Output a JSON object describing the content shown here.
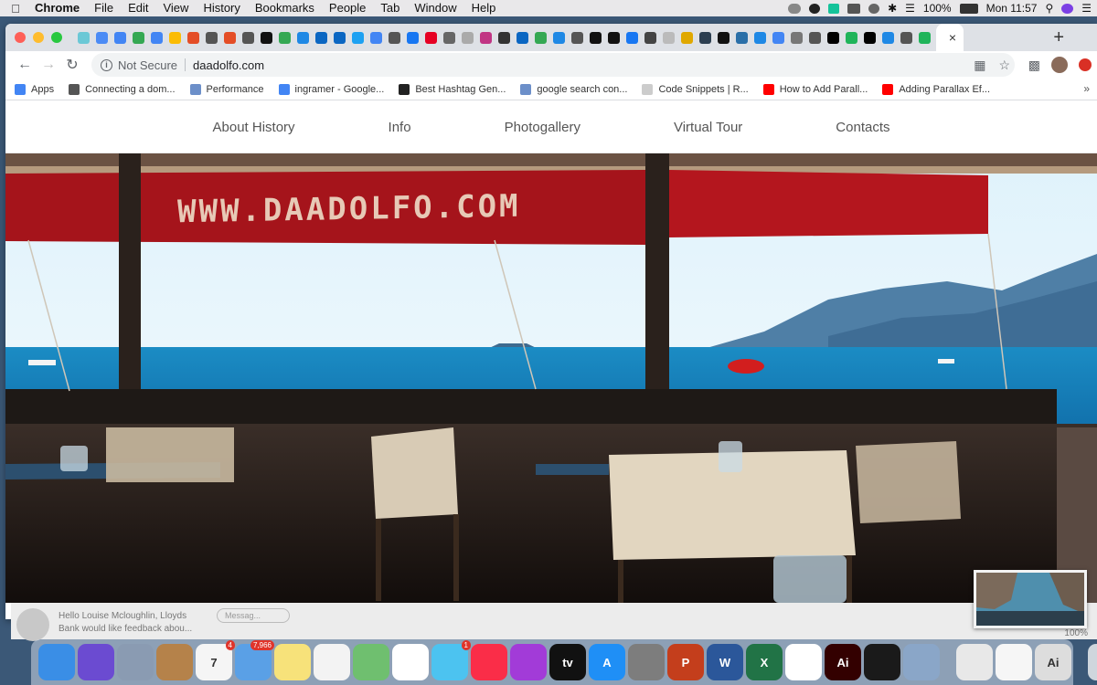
{
  "menubar": {
    "app": "Chrome",
    "items": [
      "File",
      "Edit",
      "View",
      "History",
      "Bookmarks",
      "People",
      "Tab",
      "Window",
      "Help"
    ],
    "battery": "100%",
    "clock": "Mon 11:57"
  },
  "browser": {
    "traffic_colors": [
      "#fe5f57",
      "#febc2e",
      "#28c840"
    ],
    "tab_icon_colors": [
      "#6bc8d6",
      "#4b8bf5",
      "#4285f4",
      "#34a853",
      "#4285f4",
      "#fbbc05",
      "#e44d26",
      "#555555",
      "#e44d26",
      "#555555",
      "#111111",
      "#34a853",
      "#1e88e5",
      "#0a66c2",
      "#0a66c2",
      "#1da1f2",
      "#4285f4",
      "#555555",
      "#1877f2",
      "#e60023",
      "#666666",
      "#aaaaaa",
      "#c13584",
      "#333333",
      "#0a66c2",
      "#34a853",
      "#1e88e5",
      "#555555",
      "#111111",
      "#111111",
      "#1877f2",
      "#444444",
      "#bbbbbb",
      "#e0a800",
      "#2c3e50",
      "#111111",
      "#2a6fa8",
      "#1e88e5",
      "#4285f4",
      "#777777",
      "#555555",
      "#000000",
      "#1fb45a",
      "#000000",
      "#1e88e5",
      "#555555",
      "#1fb45a"
    ],
    "active_tab_close": "×",
    "new_tab": "+",
    "address": {
      "security": "Not Secure",
      "url": "daadolfo.com"
    },
    "bookmarks": [
      {
        "label": "Apps",
        "color": "#4285f4"
      },
      {
        "label": "Connecting a dom...",
        "color": "#555555"
      },
      {
        "label": "Performance",
        "color": "#6c8fc9"
      },
      {
        "label": "ingramer - Google...",
        "color": "#4285f4"
      },
      {
        "label": "Best Hashtag Gen...",
        "color": "#222222"
      },
      {
        "label": "google search con...",
        "color": "#6c8fc9"
      },
      {
        "label": "Code Snippets | R...",
        "color": "#cccccc"
      },
      {
        "label": "How to Add Parall...",
        "color": "#ff0000"
      },
      {
        "label": "Adding Parallax Ef...",
        "color": "#ff0000"
      }
    ],
    "bookmarks_more": "»"
  },
  "site": {
    "nav": [
      "About History",
      "Info",
      "Photogallery",
      "Virtual Tour",
      "Contacts"
    ],
    "hero_banner_text": "WWW.DAADOLFO.COM"
  },
  "behind_window": {
    "message": "Hello Louise Mcloughlin, Lloyds Bank would like feedback abou...",
    "message_box": "Messag...",
    "zoom": "100%"
  },
  "dock": {
    "apps": [
      {
        "name": "finder",
        "label": "",
        "color": "#3a8ee6"
      },
      {
        "name": "siri",
        "label": "",
        "color": "#6b4bd1"
      },
      {
        "name": "launchpad",
        "label": "",
        "color": "#8a9bb2"
      },
      {
        "name": "notefile",
        "label": "",
        "color": "#b5824a"
      },
      {
        "name": "calendar",
        "label": "7",
        "color": "#f5f5f5",
        "badge": "4"
      },
      {
        "name": "mail",
        "label": "",
        "color": "#5aa0e6",
        "badge": "7,966"
      },
      {
        "name": "notes",
        "label": "",
        "color": "#f7e27a"
      },
      {
        "name": "reminders",
        "label": "",
        "color": "#f3f3f3"
      },
      {
        "name": "maps",
        "label": "",
        "color": "#6fbf6f"
      },
      {
        "name": "photos",
        "label": "",
        "color": "#ffffff"
      },
      {
        "name": "messages",
        "label": "",
        "color": "#4cc3f0",
        "badge": "1"
      },
      {
        "name": "music",
        "label": "",
        "color": "#fa2d48"
      },
      {
        "name": "podcasts",
        "label": "",
        "color": "#a23bd8"
      },
      {
        "name": "apple-tv",
        "label": "tv",
        "color": "#111111"
      },
      {
        "name": "app-store",
        "label": "A",
        "color": "#1f8ff6"
      },
      {
        "name": "system-preferences",
        "label": "",
        "color": "#7d7d7d"
      },
      {
        "name": "powerpoint",
        "label": "P",
        "color": "#c43e1c"
      },
      {
        "name": "word",
        "label": "W",
        "color": "#2b579a"
      },
      {
        "name": "excel",
        "label": "X",
        "color": "#217346"
      },
      {
        "name": "chrome",
        "label": "",
        "color": "#ffffff"
      },
      {
        "name": "illustrator",
        "label": "Ai",
        "color": "#330000"
      },
      {
        "name": "acrobat",
        "label": "",
        "color": "#1a1a1a"
      },
      {
        "name": "preview",
        "label": "",
        "color": "#8aa6c8"
      },
      {
        "name": "stack-1",
        "label": "",
        "color": "#e8e8e8"
      },
      {
        "name": "stack-2",
        "label": "",
        "color": "#f6f6f6"
      },
      {
        "name": "stack-3",
        "label": "Ai",
        "color": "#dddddd"
      },
      {
        "name": "trash",
        "label": "",
        "color": "#cfd6dd"
      }
    ]
  }
}
